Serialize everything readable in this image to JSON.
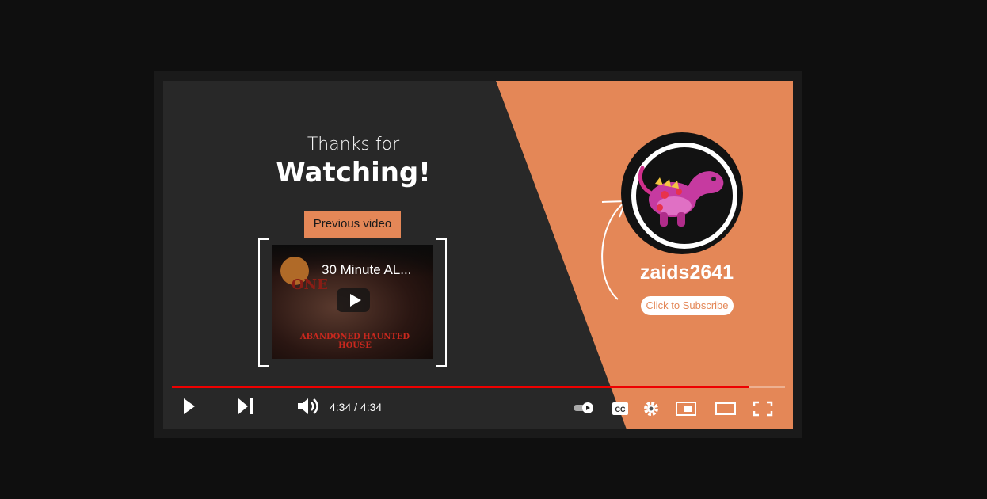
{
  "endscreen": {
    "thanks_line": "Thanks for",
    "watching_line": "Watching!",
    "previous_label": "Previous video"
  },
  "previous_video": {
    "title": "30 Minute AL...",
    "overlay_word": "ONE",
    "overlay_text": "ABANDONED HAUNTED HOUSE"
  },
  "channel": {
    "name": "zaids2641",
    "subscribe_label": "Click to Subscribe",
    "avatar_icon": "pink-dinosaur-avatar"
  },
  "player": {
    "progress_fraction": 0.94,
    "time": "4:34 / 4:34",
    "autoplay": "on"
  },
  "colors": {
    "accent": "#e48757",
    "progress": "#ee0000",
    "panel": "#282828"
  }
}
